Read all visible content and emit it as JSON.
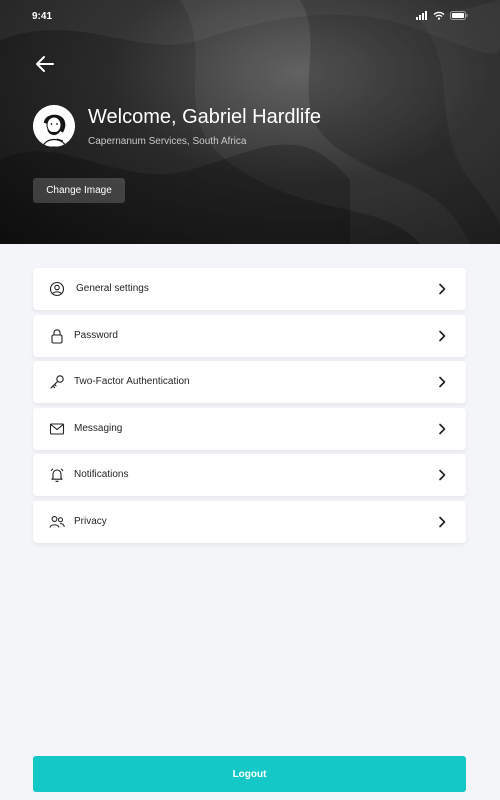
{
  "status_bar": {
    "time": "9:41",
    "icons": [
      "signal-icon",
      "wifi-icon",
      "battery-icon"
    ]
  },
  "header": {
    "back_icon": "arrow-left-icon",
    "welcome": "Welcome, Gabriel Hardlife",
    "subtitle": "Capernanum Services, South Africa",
    "change_image_label": "Change Image"
  },
  "menu": {
    "items": [
      {
        "label": "General settings",
        "icon": "user-circle-icon"
      },
      {
        "label": "Password",
        "icon": "lock-icon"
      },
      {
        "label": "Two-Factor Authentication",
        "icon": "key-icon"
      },
      {
        "label": "Messaging",
        "icon": "mail-icon"
      },
      {
        "label": "Notifications",
        "icon": "bell-icon"
      },
      {
        "label": "Privacy",
        "icon": "users-icon"
      }
    ]
  },
  "logout_label": "Logout",
  "colors": {
    "accent": "#14c8c8",
    "background": "#f4f5f8",
    "header_dark": "#1a1a1a"
  }
}
